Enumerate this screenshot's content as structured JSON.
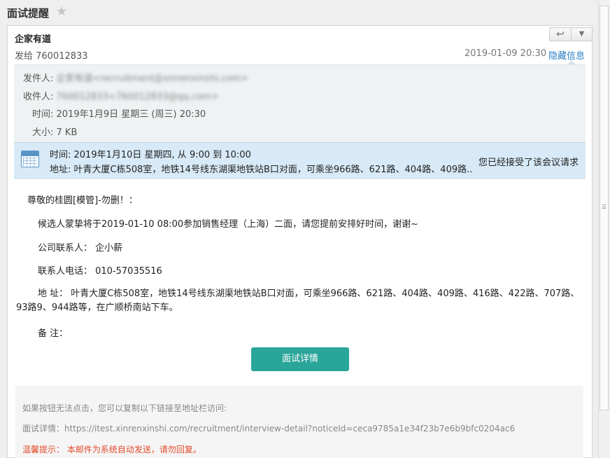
{
  "window": {
    "title": "面试提醒"
  },
  "header": {
    "sender_name": "企家有道",
    "sent_to": "发给 760012833",
    "datetime": "2019-01-09 20:30",
    "hide_info_label": "隐藏信息"
  },
  "details": {
    "from_label": "发件人:",
    "from_value": "企家有道<recruitment@xinrenxinshi.com>",
    "to_label": "收件人:",
    "to_value": "760012833<760012833@qq.com>",
    "time_label": "时间:",
    "time_value": "2019年1月9日 星期三 (周三) 20:30",
    "size_label": "大小:",
    "size_value": "7 KB"
  },
  "meeting": {
    "time": "时间: 2019年1月10日 星期四, 从 9:00 到 10:00",
    "address": "地址: 叶青大厦C栋508室，地铁14号线东湖渠地铁站B口对面，可乘坐966路、621路、404路、409路...",
    "status": "您已经接受了该会议请求"
  },
  "body": {
    "greeting": "尊敬的桂圆[模管]-勿删！：",
    "intro": "候选人蒙挚将于2019-01-10 08:00参加销售经理（上海）二面，请您提前安排好时间，谢谢~",
    "contact": "公司联系人：  企小薪",
    "phone": "联系人电话：  010-57035516",
    "address": "地 址：  叶青大厦C栋508室，地铁14号线东湖渠地铁站B口对面，可乘坐966路、621路、404路、409路、416路、422路、707路、93路9、944路等，在广顺桥南站下车。",
    "remark": "备 注："
  },
  "cta": {
    "label": "面试详情"
  },
  "footer": {
    "hint": "如果按钮无法点击，您可以复制以下链接至地址栏访问:",
    "link": "面试详情：https://itest.xinrenxinshi.com/recruitment/interview-detail?noticeId=ceca9785a1e34f23b7e6b9bfc0204ac6",
    "warning": "温馨提示： 本邮件为系统自动发送，请勿回复。"
  },
  "icons": {
    "star": "star-icon",
    "reply": "reply-icon",
    "dropdown": "chevron-down-icon",
    "calendar": "calendar-icon"
  },
  "colors": {
    "link": "#2a7ec2",
    "button": "#2aa59a",
    "warning": "#e24a2b",
    "meeting_bg": "#d8eaf7"
  }
}
